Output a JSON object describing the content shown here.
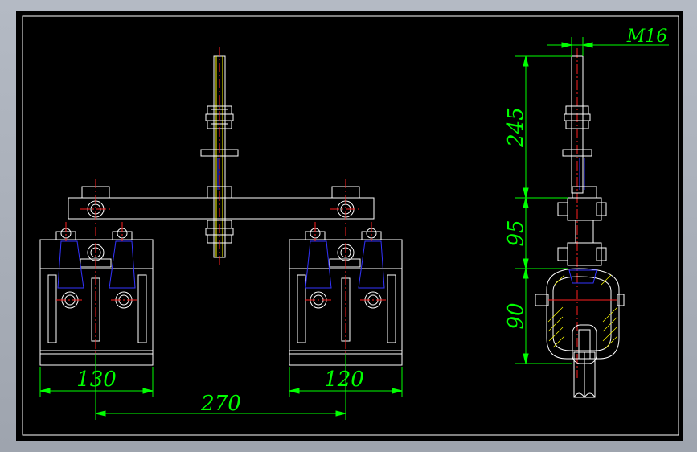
{
  "drawing": {
    "dimensions": {
      "left_width": "130",
      "right_width": "120",
      "center_spacing": "270",
      "thread": "M16",
      "height_top": "245",
      "height_middle": "95",
      "height_bottom": "90"
    },
    "colors": {
      "background": "#000000",
      "outline": "#ffffff",
      "dimension": "#00ff00",
      "centerline": "#ff0000",
      "hidden_detail": "#0000ff",
      "hatch": "#ffff00",
      "frame": "#a8aeb8"
    }
  }
}
